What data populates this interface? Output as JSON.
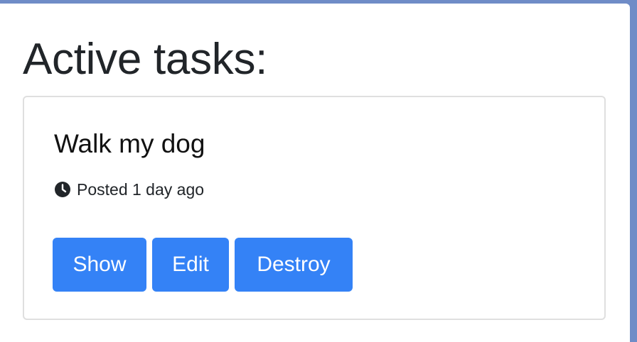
{
  "page": {
    "heading": "Active tasks:"
  },
  "task": {
    "title": "Walk my dog",
    "posted": "Posted 1 day ago",
    "icon": "clock-icon"
  },
  "actions": {
    "show_label": "Show",
    "edit_label": "Edit",
    "destroy_label": "Destroy"
  },
  "colors": {
    "primary": "#3482f6",
    "card_border": "#dfdfdf",
    "background": "#6f8cc7"
  }
}
